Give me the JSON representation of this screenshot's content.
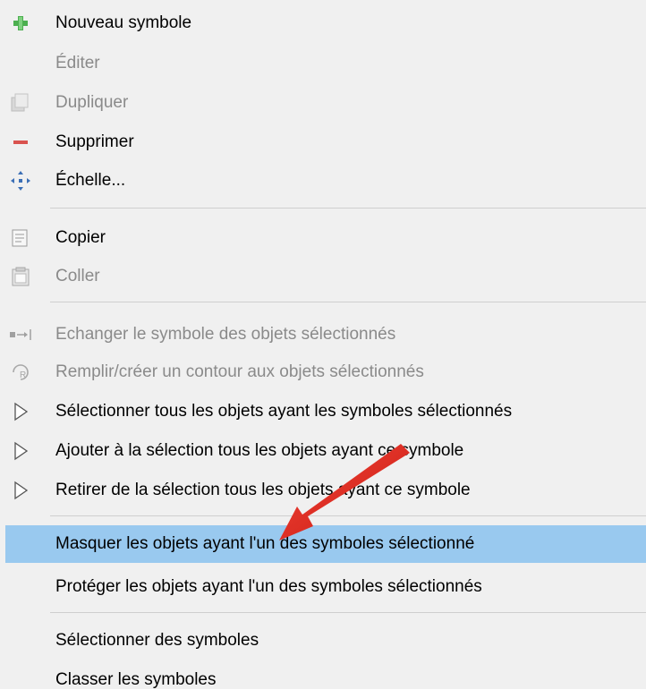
{
  "menu": {
    "items": [
      {
        "label": "Nouveau symbole",
        "icon": "plus-icon",
        "enabled": true
      },
      {
        "label": "Éditer",
        "icon": "",
        "enabled": false
      },
      {
        "label": "Dupliquer",
        "icon": "duplicate-icon",
        "enabled": false
      },
      {
        "label": "Supprimer",
        "icon": "minus-icon",
        "enabled": true
      },
      {
        "label": "Échelle...",
        "icon": "scale-icon",
        "enabled": true
      },
      {
        "label": "Copier",
        "icon": "copy-icon",
        "enabled": true
      },
      {
        "label": "Coller",
        "icon": "paste-icon",
        "enabled": false
      },
      {
        "label": "Echanger le symbole des objets sélectionnés",
        "icon": "swap-icon",
        "enabled": false
      },
      {
        "label": "Remplir/créer un contour aux objets sélectionnés",
        "icon": "fill-outline-icon",
        "enabled": false
      },
      {
        "label": "Sélectionner tous les objets ayant les symboles sélectionnés",
        "icon": "cursor-icon",
        "enabled": true
      },
      {
        "label": "Ajouter à la sélection tous les objets ayant ce symbole",
        "icon": "cursor-icon",
        "enabled": true
      },
      {
        "label": "Retirer de la sélection tous les objets ayant ce symbole",
        "icon": "cursor-icon",
        "enabled": true
      },
      {
        "label": "Masquer les objets ayant l'un des symboles sélectionné",
        "icon": "",
        "enabled": true,
        "highlighted": true
      },
      {
        "label": "Protéger les objets ayant l'un des symboles sélectionnés",
        "icon": "",
        "enabled": true
      },
      {
        "label": "Sélectionner des symboles",
        "icon": "",
        "enabled": true
      },
      {
        "label": "Classer les symboles",
        "icon": "",
        "enabled": true
      }
    ]
  },
  "colors": {
    "highlight": "#99c9ef",
    "disabled_text": "#8a8a8a",
    "annotation_arrow": "#e8271b"
  }
}
